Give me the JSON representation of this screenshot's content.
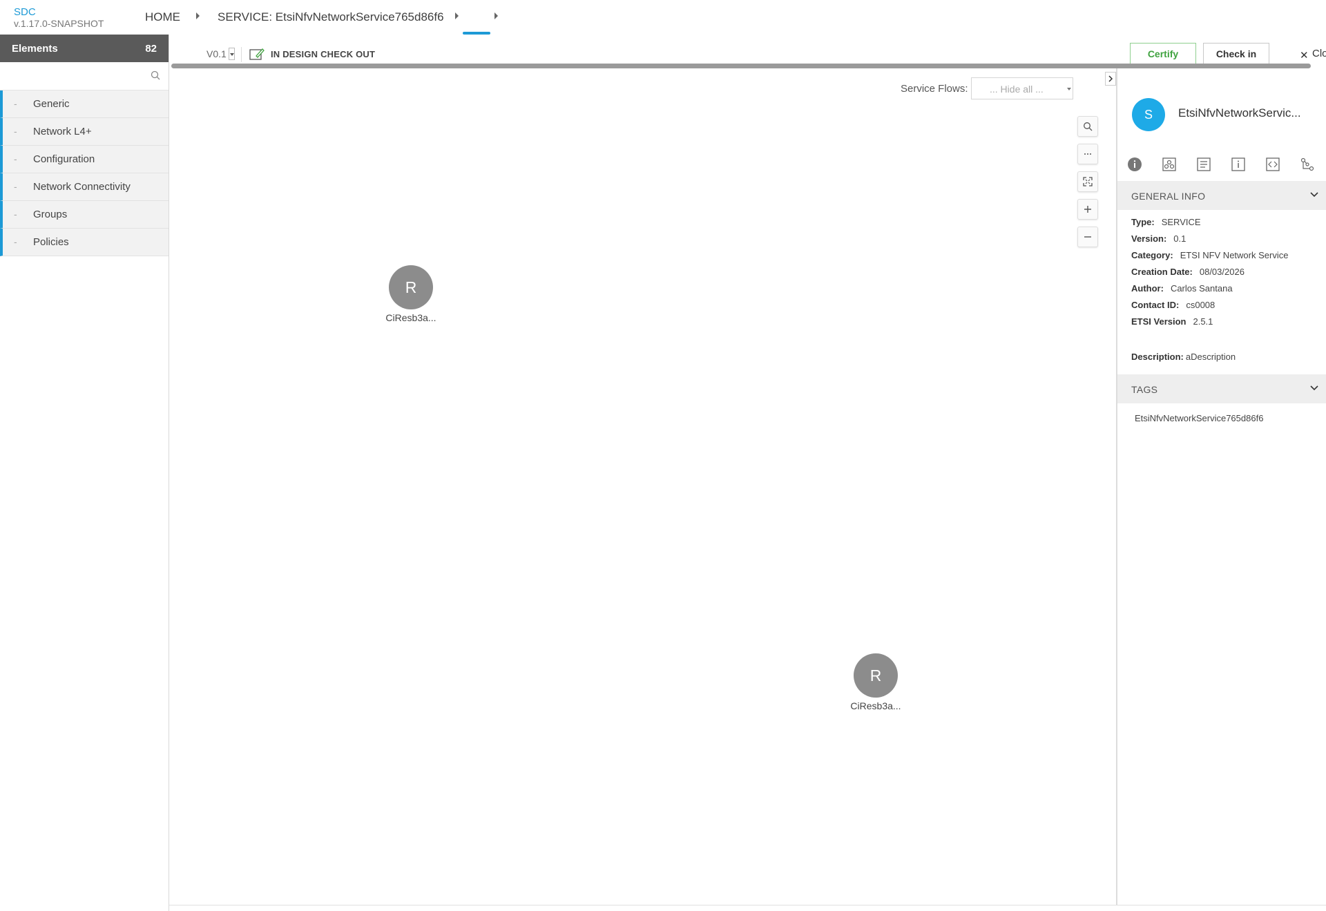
{
  "header": {
    "brand": "SDC",
    "version": "v.1.17.0-SNAPSHOT",
    "breadcrumbs": [
      "HOME",
      "SERVICE: EtsiNfvNetworkService765d86f6"
    ]
  },
  "palette": {
    "title": "Elements",
    "count": "82",
    "search_placeholder": "",
    "categories": [
      {
        "label": "Generic"
      },
      {
        "label": "Network L4+"
      },
      {
        "label": "Configuration"
      },
      {
        "label": "Network Connectivity"
      },
      {
        "label": "Groups"
      },
      {
        "label": "Policies"
      }
    ]
  },
  "toolbar": {
    "version": "V0.1",
    "status": "IN DESIGN CHECK OUT",
    "certify": "Certify",
    "checkin": "Check in",
    "close": "Clo"
  },
  "canvas": {
    "service_flows_label": "Service Flows:",
    "service_flows_value": "... Hide all ...",
    "nodes": [
      {
        "initial": "R",
        "label": "CiResb3a..."
      },
      {
        "initial": "R",
        "label": "CiResb3a..."
      }
    ]
  },
  "right_panel": {
    "avatar": "S",
    "title": "EtsiNfvNetworkServic...",
    "general_info_title": "GENERAL INFO",
    "info": [
      {
        "key": "Type:",
        "value": "SERVICE"
      },
      {
        "key": "Version:",
        "value": "0.1"
      },
      {
        "key": "Category:",
        "value": "ETSI NFV Network Service"
      },
      {
        "key": "Creation Date:",
        "value": "08/03/2026"
      },
      {
        "key": "Author:",
        "value": "Carlos Santana"
      },
      {
        "key": "Contact ID:",
        "value": "cs0008"
      },
      {
        "key": "ETSI Version",
        "value": "2.5.1"
      }
    ],
    "description_key": "Description:",
    "description_value": "aDescription",
    "tags_title": "TAGS",
    "tags": [
      "EtsiNfvNetworkService765d86f6"
    ]
  },
  "colors": {
    "accent": "#1d9ad6",
    "avatar": "#1eaae7",
    "certify": "#3fa23f",
    "node": "#8c8c8c",
    "palette_header": "#5a5a5a"
  }
}
